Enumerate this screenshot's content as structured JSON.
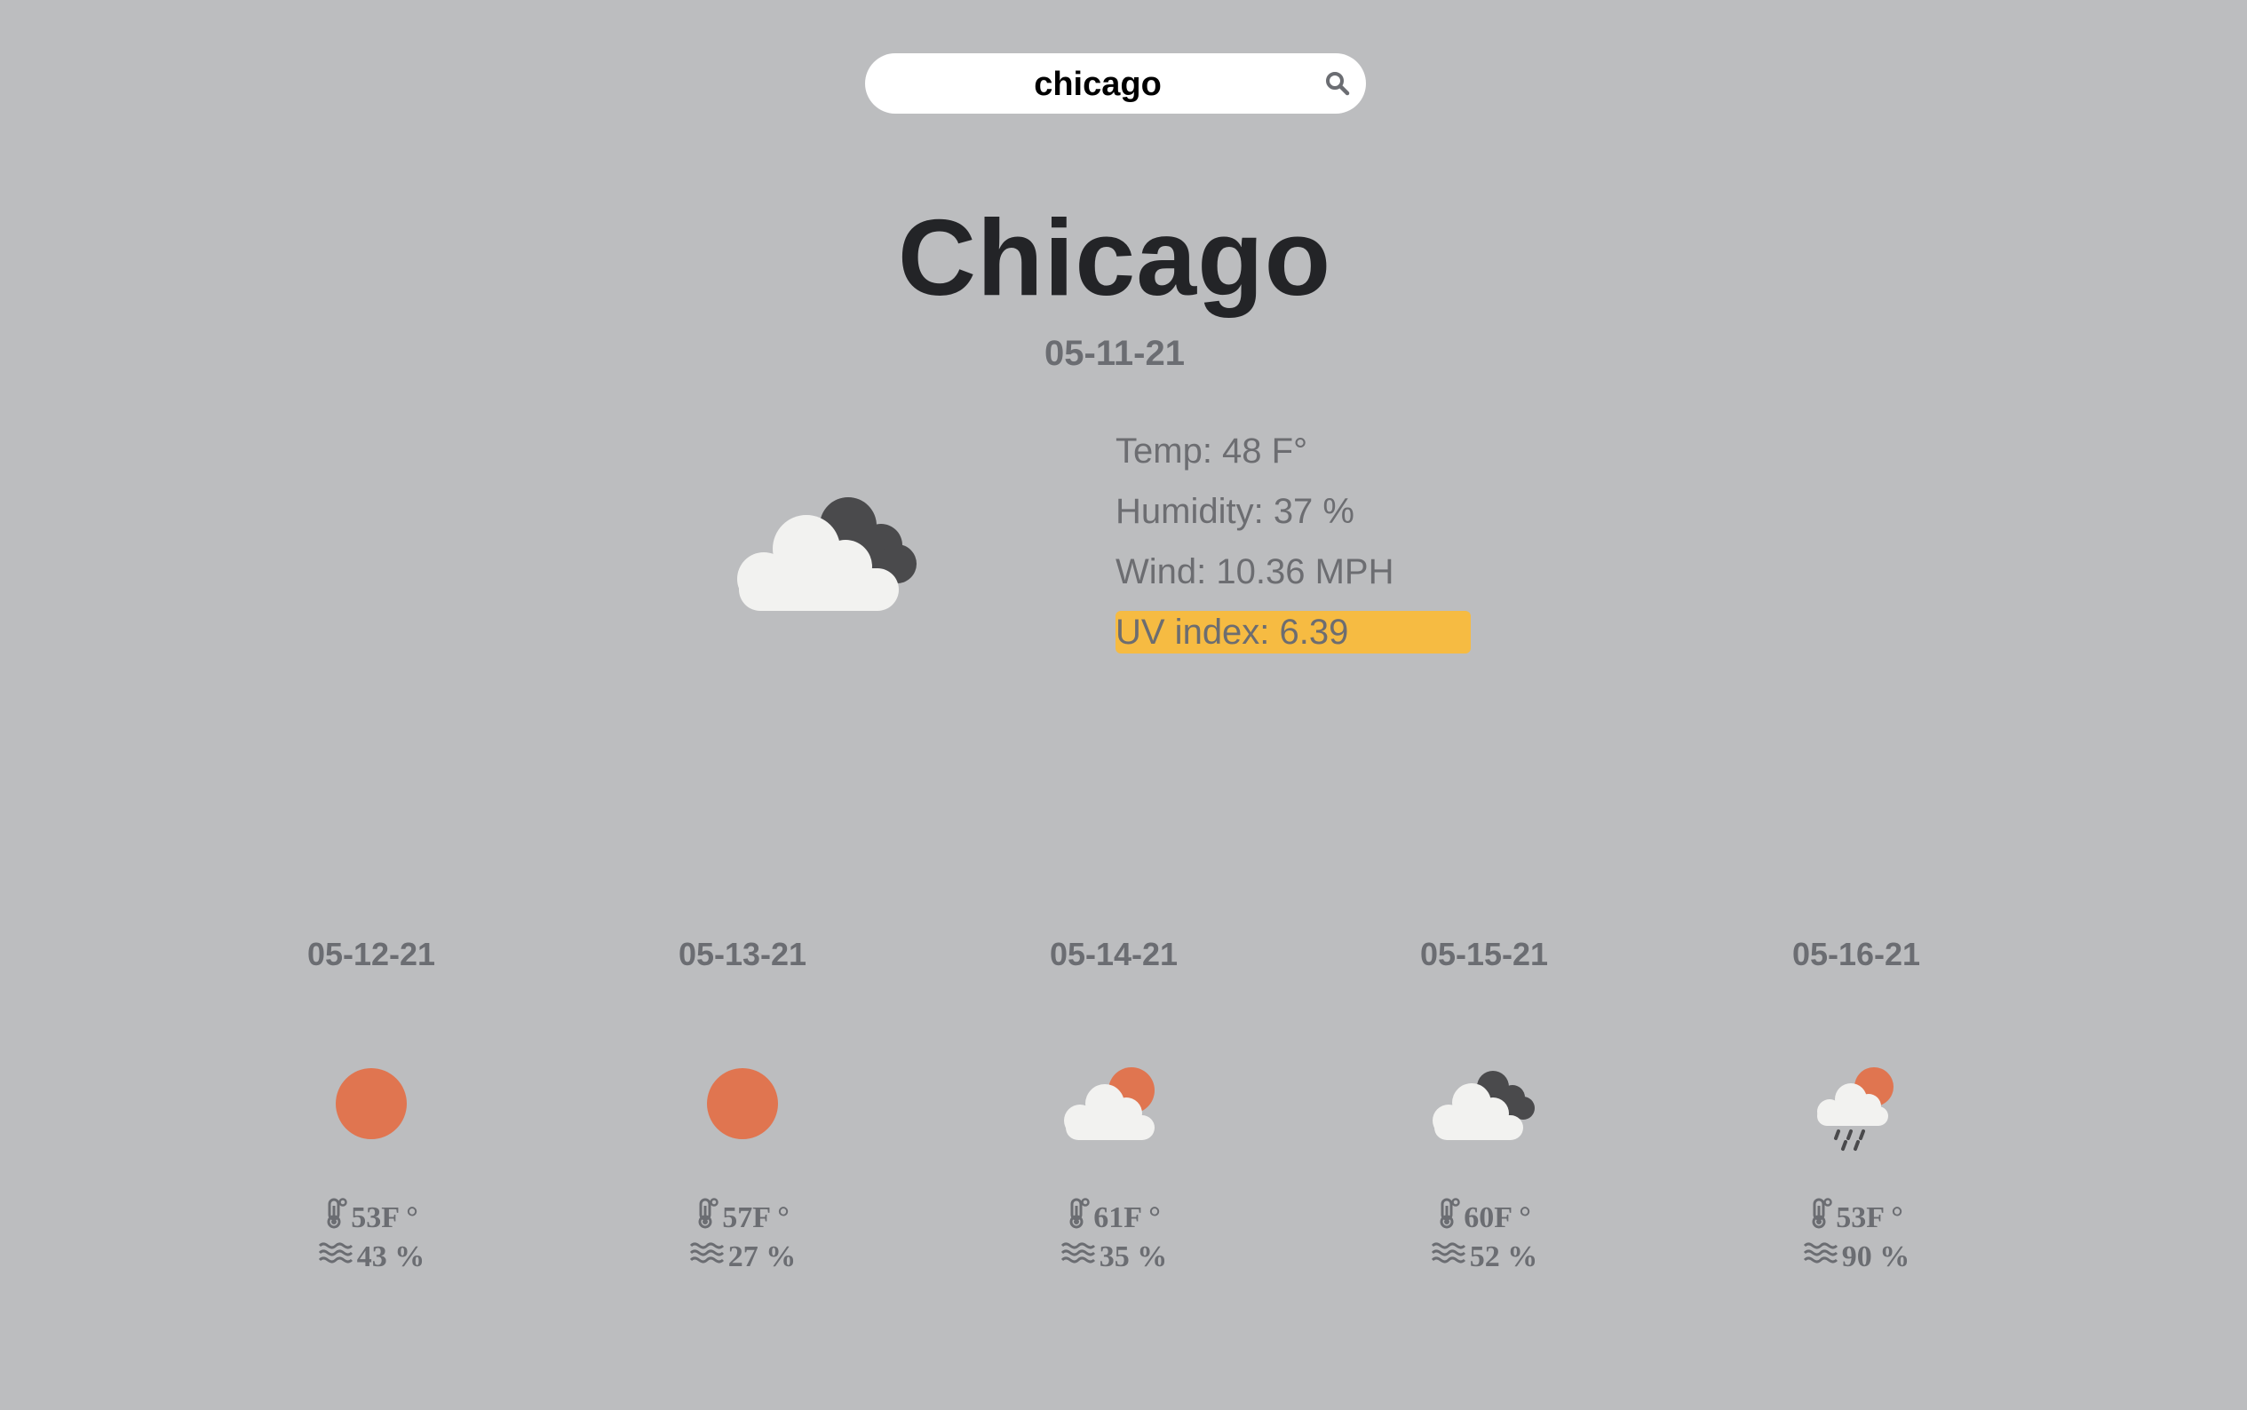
{
  "search": {
    "value": "chicago",
    "icon": "search-icon"
  },
  "current": {
    "city": "Chicago",
    "date": "05-11-21",
    "icon": "cloudy-icon",
    "temp_text": "Temp: 48 F°",
    "humidity_text": "Humidity: 37 %",
    "wind_text": "Wind: 10.36 MPH",
    "uv_text": "UV index: 6.39",
    "uv_color": "#f6bb42"
  },
  "forecast": [
    {
      "date": "05-12-21",
      "icon": "sun-icon",
      "temp": "53F °",
      "humidity": "43 %"
    },
    {
      "date": "05-13-21",
      "icon": "sun-icon",
      "temp": "57F °",
      "humidity": "27 %"
    },
    {
      "date": "05-14-21",
      "icon": "partly-cloudy-icon",
      "temp": "61F °",
      "humidity": "35 %"
    },
    {
      "date": "05-15-21",
      "icon": "cloudy-icon",
      "temp": "60F °",
      "humidity": "52 %"
    },
    {
      "date": "05-16-21",
      "icon": "rain-icon",
      "temp": "53F °",
      "humidity": "90 %"
    }
  ],
  "colors": {
    "background": "#bcbdbf",
    "sun": "#e07550",
    "cloud_light": "#f2f2f0",
    "cloud_dark": "#4a4a4c"
  }
}
